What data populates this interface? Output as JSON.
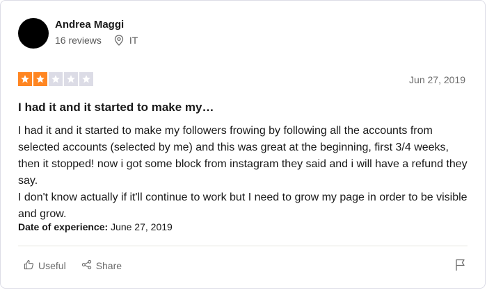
{
  "review": {
    "consumer": {
      "name": "Andrea Maggi",
      "reviews_count": "16 reviews",
      "country": "IT"
    },
    "rating": {
      "value": 2,
      "max": 5,
      "filled_color": "#ff8622",
      "empty_color": "#dcdce6"
    },
    "date": "Jun 27, 2019",
    "title": "I had it and it started to make my…",
    "body": [
      "I had it and it started to make my followers frowing by following all the accounts from selected accounts (selected by me) and this was great at the beginning, first 3/4 weeks, then it stopped! now i got some block from instagram they said and i will have a refund they say.",
      "I don't know actually if it'll continue to work but I need to grow my page in order to be visible and grow."
    ],
    "experience": {
      "label": "Date of experience:",
      "value": "June 27, 2019"
    },
    "actions": {
      "useful_label": "Useful",
      "share_label": "Share"
    }
  },
  "icons": {
    "location": "location-pin-icon",
    "useful": "thumbs-up-icon",
    "share": "share-icon",
    "report": "flag-icon"
  }
}
